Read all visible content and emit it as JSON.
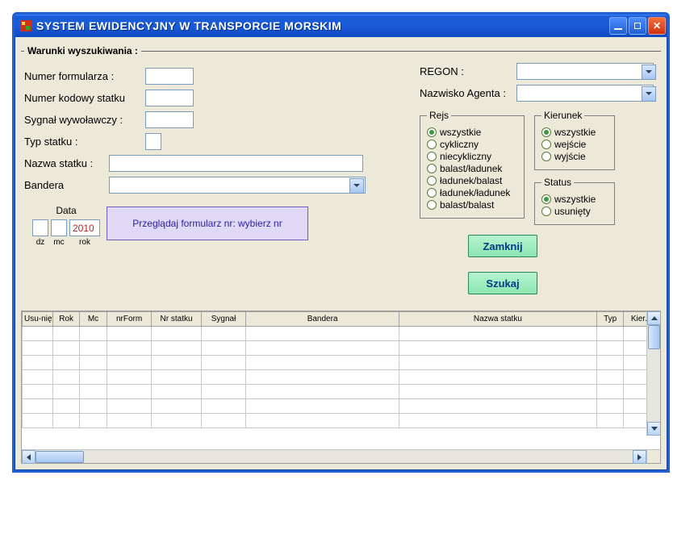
{
  "window": {
    "title": "SYSTEM  EWIDENCYJNY  W  TRANSPORCIE  MORSKIM"
  },
  "search": {
    "legend": "Warunki wyszukiwania :",
    "numer_formularza_label": "Numer formularza :",
    "numer_formularza_value": "",
    "numer_kodowy_label": "Numer kodowy statku",
    "numer_kodowy_value": "",
    "sygnal_label": "Sygnał wywoławczy :",
    "sygnal_value": "",
    "typ_label": "Typ statku :",
    "typ_value": "",
    "nazwa_statku_label": "Nazwa statku :",
    "nazwa_statku_value": "",
    "bandera_label": "Bandera",
    "bandera_value": "",
    "regon_label": "REGON :",
    "regon_value": "",
    "agent_label": "Nazwisko Agenta :",
    "agent_value": ""
  },
  "rejs": {
    "legend": "Rejs",
    "options": {
      "wszystkie": "wszystkie",
      "cykliczny": "cykliczny",
      "niecykliczny": "niecykliczny",
      "balast_ladunek": "balast/ładunek",
      "ladunek_balast": "ładunek/balast",
      "ladunek_ladunek": "ładunek/ładunek",
      "balast_balast": "balast/balast"
    },
    "selected": "wszystkie"
  },
  "kierunek": {
    "legend": "Kierunek",
    "options": {
      "wszystkie": "wszystkie",
      "wejscie": "wejście",
      "wyjscie": "wyjście"
    },
    "selected": "wszystkie"
  },
  "status": {
    "legend": "Status",
    "options": {
      "wszystkie": "wszystkie",
      "usuniety": "usunięty"
    },
    "selected": "wszystkie"
  },
  "data": {
    "label": "Data",
    "dz": "",
    "mc": "",
    "rok": "2010",
    "dz_cap": "dz",
    "mc_cap": "mc",
    "rok_cap": "rok"
  },
  "buttons": {
    "browse": "Przeglądaj formularz nr:  wybierz nr",
    "close": "Zamknij",
    "search": "Szukaj"
  },
  "table": {
    "headers": {
      "usuniety": "Usu-nięty",
      "rok": "Rok",
      "mc": "Mc",
      "nrform": "nrForm",
      "nrstatku": "Nr statku",
      "sygnal": "Sygnał",
      "bandera": "Bandera",
      "nazwa": "Nazwa statku",
      "typ": "Typ",
      "kier": "Kier.E"
    }
  }
}
